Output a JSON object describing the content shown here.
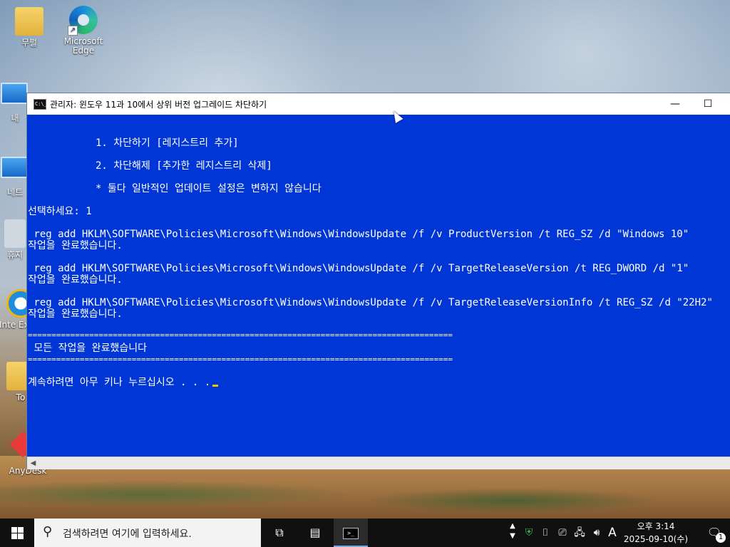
{
  "desktop": {
    "icons": [
      {
        "label": "무펄"
      },
      {
        "label": "Microsoft Edge"
      },
      {
        "label": "내"
      },
      {
        "label": "네트"
      },
      {
        "label": "휴지"
      },
      {
        "label": "Inte Explo"
      },
      {
        "label": "To"
      },
      {
        "label": "AnyDesk"
      }
    ]
  },
  "console": {
    "title": "관리자:  윈도우 11과 10에서 상위 버전 업그레이드 차단하기",
    "icon_text": "C:\\_",
    "lines": {
      "menu1": "1. 차단하기 [레지스트리 추가]",
      "menu2": "2. 차단해제 [추가한 레지스트리 삭제]",
      "note": "* 둘다 일반적인 업데이트 설정은 변하지 않습니다",
      "prompt": "선택하세요: 1",
      "cmd1": " reg add HKLM\\SOFTWARE\\Policies\\Microsoft\\Windows\\WindowsUpdate /f /v ProductVersion /t REG_SZ /d \"Windows 10\"",
      "done1": "작업을 완료했습니다.",
      "cmd2": " reg add HKLM\\SOFTWARE\\Policies\\Microsoft\\Windows\\WindowsUpdate /f /v TargetReleaseVersion /t REG_DWORD /d \"1\"",
      "done2": "작업을 완료했습니다.",
      "cmd3": " reg add HKLM\\SOFTWARE\\Policies\\Microsoft\\Windows\\WindowsUpdate /f /v TargetReleaseVersionInfo /t REG_SZ /d \"22H2\"",
      "done3": "작업을 완료했습니다.",
      "sep1": "==========================================================================================",
      "all_done": " 모든 작업을 완료했습니다",
      "sep2": "==========================================================================================",
      "press_key": "계속하려면 아무 키나 누르십시오 . . ."
    },
    "minimize_icon": "minimize-icon",
    "maximize_icon": "maximize-icon"
  },
  "taskbar": {
    "search_placeholder": "검색하려면 여기에 입력하세요.",
    "tray": {
      "ime": "A",
      "time": "오후 3:14",
      "date": "2025-09-10(수)",
      "notifications_count": "1"
    }
  },
  "colors": {
    "console_bg": "#0136d6",
    "console_fg": "#ffffff",
    "cursor": "#f2c100",
    "taskbar_bg": "#101010"
  }
}
